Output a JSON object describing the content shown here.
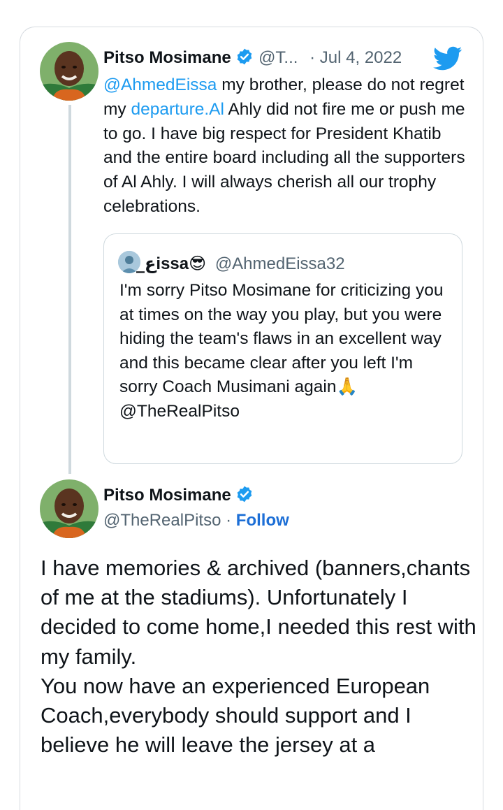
{
  "tweet": {
    "author_name": "Pitso Mosimane",
    "handle_truncated": "@T...",
    "separator": "·",
    "date": "Jul 4, 2022",
    "mention": "@AhmedEissa",
    "text_a": " my brother, please do not regret my ",
    "link_text": "departure.Al",
    "text_b": " Ahly did not fire me or push me to go. I have big respect for President Khatib and the entire board including all the supporters of Al Ahly. I will always cherish all our trophy celebrations."
  },
  "quote": {
    "author_name": "ع̲issa😎",
    "handle": "@AhmedEissa32",
    "text": "I'm sorry Pitso Mosimane for criticizing you at times on the way you play, but you were hiding the team's flaws in an excellent way and this became clear after you left I'm sorry Coach Musimani again🙏",
    "mention": "@TheRealPitso"
  },
  "reply": {
    "author_name": "Pitso Mosimane",
    "handle": "@TheRealPitso",
    "separator": "·",
    "follow_label": "Follow",
    "text": "I have memories & archived (banners,chants of me at the stadiums). Unfortunately I decided to come home,I needed this rest with my family.\nYou now have an experienced European Coach,everybody should support and I believe he will leave the jersey at a"
  },
  "colors": {
    "link": "#1d9bf0",
    "follow": "#1d6fd6",
    "verified": "#1d9bf0",
    "twitter_bird": "#1d9bf0"
  },
  "icons": [
    "verified-badge-icon",
    "twitter-bird-icon"
  ]
}
